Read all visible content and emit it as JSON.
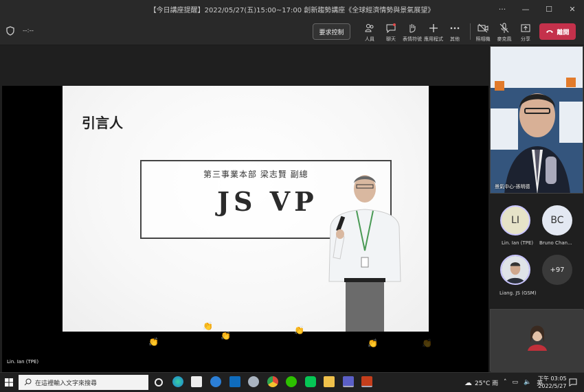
{
  "window": {
    "title": "【今日講座提醒】2022/05/27(五)15:00~17:00 創新趨勢講座《全球經濟情勢與景氣展望》"
  },
  "toolbar": {
    "timer": "--:--",
    "request_control": "要求控制",
    "items": [
      {
        "label": "人員"
      },
      {
        "label": "聊天"
      },
      {
        "label": "表情符號"
      },
      {
        "label": "應用程式"
      },
      {
        "label": "其他"
      },
      {
        "label": "照相機"
      },
      {
        "label": "麥克風"
      },
      {
        "label": "分享"
      }
    ],
    "leave": "離開"
  },
  "slide": {
    "heading": "引言人",
    "subtitle": "第三事業本部 梁志賢 副總",
    "name": "JS VP"
  },
  "stage": {
    "presenter_caption": "Lin. Ian (TPE)"
  },
  "participants": {
    "speaker_name": "景氣中心-孫明德",
    "list": [
      {
        "initials": "LI",
        "name": "Lin. Ian (TPE)"
      },
      {
        "initials": "BC",
        "name": "Bruno Chan..."
      },
      {
        "initials": "",
        "name": "Liang. JS (GSM)"
      },
      {
        "initials": "+97",
        "name": ""
      }
    ]
  },
  "taskbar": {
    "search_placeholder": "在這裡輸入文字來搜尋",
    "weather": "25°C 雨",
    "ime": "英",
    "time": "下午 03:05",
    "date": "2022/5/27"
  },
  "colors": {
    "leave": "#c4314b",
    "background": "#1f1f1f"
  }
}
